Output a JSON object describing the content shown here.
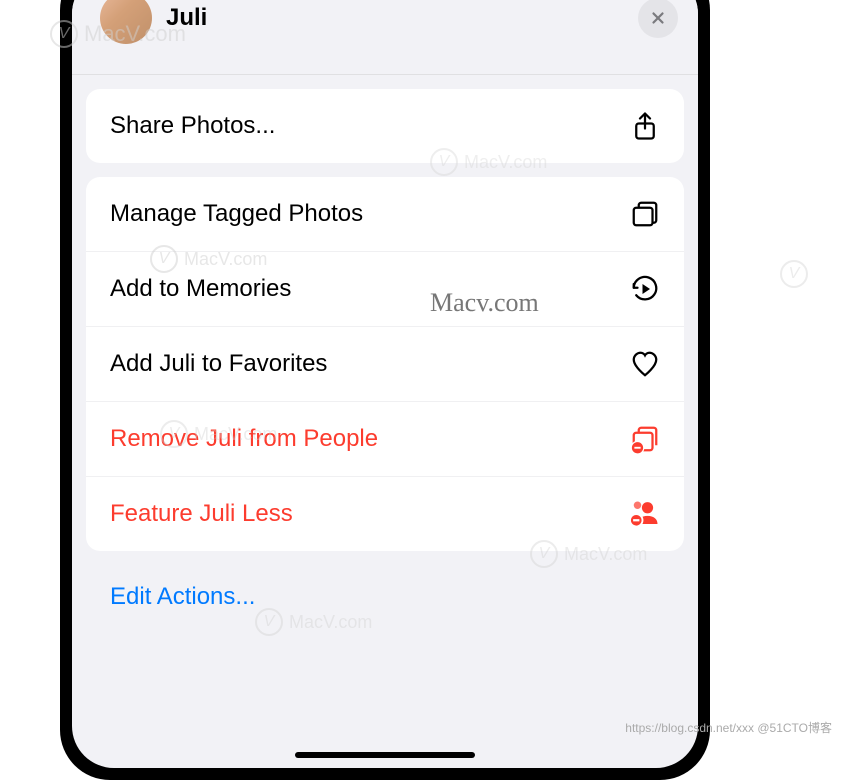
{
  "header": {
    "person_name": "Juli"
  },
  "menu": {
    "share_photos": "Share Photos...",
    "manage_tagged": "Manage Tagged Photos",
    "add_memories": "Add to Memories",
    "add_favorites": "Add Juli to Favorites",
    "remove_people": "Remove Juli from People",
    "feature_less": "Feature Juli Less"
  },
  "edit_actions": "Edit Actions...",
  "watermark_text": "MacV.com",
  "macv_center": "Macv.com",
  "footer": "https://blog.csdn.net/xxx @51CTO博客",
  "colors": {
    "destructive": "#fc3c2e",
    "link": "#007aff",
    "background": "#f2f2f6"
  }
}
